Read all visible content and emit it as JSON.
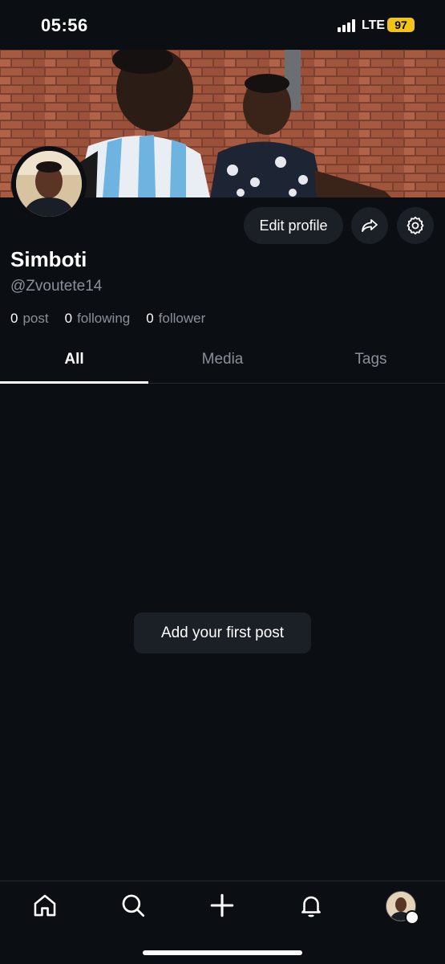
{
  "status_bar": {
    "time": "05:56",
    "network": "LTE",
    "battery": "97"
  },
  "profile": {
    "display_name": "Simboti",
    "handle": "@Zvoutete14",
    "edit_label": "Edit profile",
    "stats": [
      {
        "value": "0",
        "label": "post"
      },
      {
        "value": "0",
        "label": "following"
      },
      {
        "value": "0",
        "label": "follower"
      }
    ]
  },
  "tabs": [
    {
      "label": "All",
      "active": true
    },
    {
      "label": "Media",
      "active": false
    },
    {
      "label": "Tags",
      "active": false
    }
  ],
  "empty_state": {
    "cta": "Add your first post"
  },
  "bottom_nav": {
    "items": [
      "home-icon",
      "search-icon",
      "plus-icon",
      "bell-icon",
      "profile-avatar"
    ]
  },
  "icons": {
    "share": "share-arrow-icon",
    "settings": "gear-icon"
  },
  "colors": {
    "background": "#0b0e13",
    "surface": "#1b1f26",
    "muted_text": "#8a8f98",
    "battery": "#f2c318"
  }
}
